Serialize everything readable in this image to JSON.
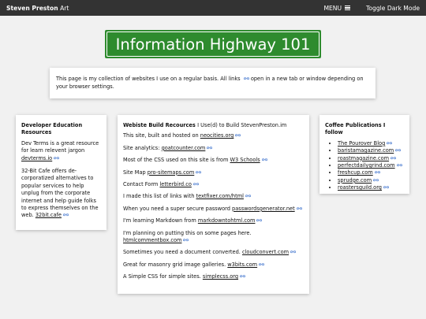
{
  "topbar": {
    "brand_bold": "Steven Preston",
    "brand_rest": "Art",
    "menu_label": "MENU",
    "dark_mode_label": "Toggle Dark Mode"
  },
  "sign": {
    "title": "Information Highway 101"
  },
  "intro": {
    "text_before": "This page is my collection of websites I use on a regular basis. All links",
    "text_after": "open in a new tab or window depending on your browser settings."
  },
  "dev": {
    "heading": "Developer Education Resources",
    "items": [
      {
        "text": "Dev Terms is a great resource for learn relevent jargon",
        "link": "devterms.io"
      },
      {
        "text": "32-Bit Cafe offers de-corporatized alternatives to popular services to help unplug from the corporate internet and help guide folks to express themselves on the web.",
        "link": "32bit.cafe"
      }
    ]
  },
  "build": {
    "heading_bold": "Webiste Build Recources",
    "heading_rest": "I Use(d) to Build StevenPreston.im",
    "items": [
      {
        "text": "This site, built and hosted on",
        "link": "neocities.org"
      },
      {
        "text": "Site analytics:",
        "link": "goatcounter.com"
      },
      {
        "text": "Most of the CSS used on this site is from",
        "link": "W3 Schools"
      },
      {
        "text": "Site Map",
        "link": "pro-sitemaps.com"
      },
      {
        "text": "Contact Form",
        "link": "letterbird.co"
      },
      {
        "text": "I made this list of links with",
        "link": "textfixer.com/html"
      },
      {
        "text": "When you need a super secure password",
        "link": "passwordsgenerator.net"
      },
      {
        "text": "I'm learning Markdown from",
        "link": "markdowntohtml.com"
      },
      {
        "text": "I'm planning on putting this on some pages here.",
        "link": "htmlcommentbox.com"
      },
      {
        "text": "Sometimes you need a document converted.",
        "link": "cloudconvert.com"
      },
      {
        "text": "Great for masonry grid image galleries.",
        "link": "w3bits.com"
      },
      {
        "text": "A Simple CSS for simple sites.",
        "link": "simplecss.org"
      }
    ]
  },
  "coffee": {
    "heading": "Coffee Publications I follow",
    "items": [
      "The Pourover Blog",
      "baristamagazine.com",
      "roastmagazine.com",
      "perfectdailygrind.com",
      "freshcup.com",
      "sprudge.com",
      "roastersguild.org"
    ]
  },
  "icons": {
    "external": "external-link-icon",
    "menu": "hamburger-menu-icon"
  }
}
